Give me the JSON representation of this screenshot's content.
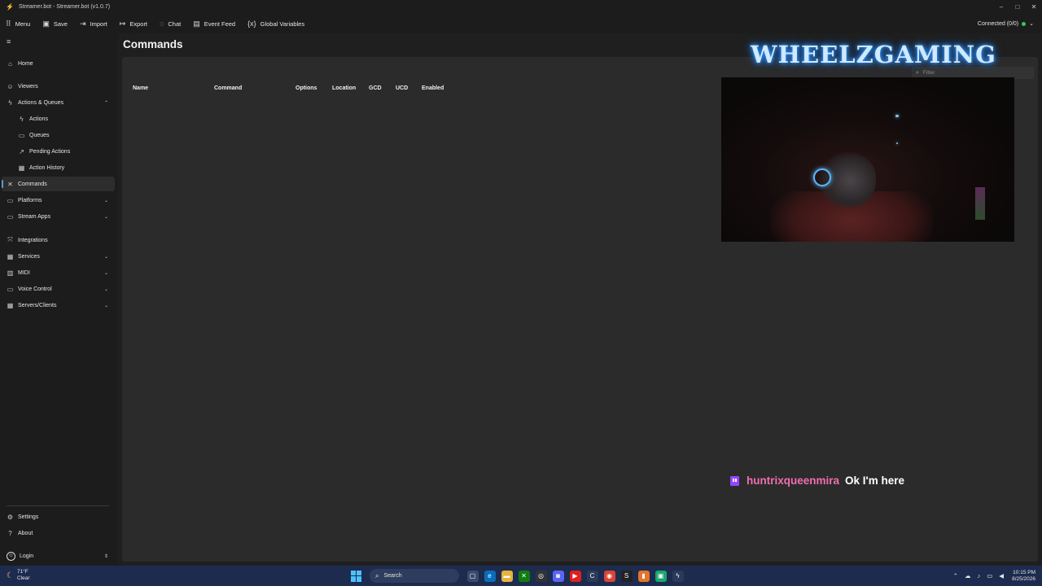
{
  "window": {
    "title": "Streamer.bot - Streamer.bot (v1.0.7)",
    "controls": [
      "–",
      "□",
      "✕"
    ]
  },
  "toolbar": {
    "items": [
      {
        "label": "Menu",
        "icon": "grid-icon"
      },
      {
        "label": "Save",
        "icon": "save-icon"
      },
      {
        "label": "Import",
        "icon": "import-icon"
      },
      {
        "label": "Export",
        "icon": "export-icon"
      },
      {
        "label": "Chat",
        "icon": "chat-icon"
      },
      {
        "label": "Event Feed",
        "icon": "feed-icon"
      },
      {
        "label": "Global Variables",
        "icon": "variables-icon"
      }
    ],
    "connection": "Connected (0/0)",
    "connection_color": "#35c759"
  },
  "sidebar": {
    "items": [
      {
        "label": "Home",
        "icon": "home-icon"
      },
      {
        "label": "Viewers",
        "icon": "viewers-icon"
      },
      {
        "label": "Actions & Queues",
        "icon": "actions-icon",
        "expanded": true
      },
      {
        "label": "Actions",
        "icon": "bolt-icon"
      },
      {
        "label": "Queues",
        "icon": "queue-icon"
      },
      {
        "label": "Pending Actions",
        "icon": "pending-icon"
      },
      {
        "label": "Action History",
        "icon": "history-icon"
      },
      {
        "label": "Commands",
        "icon": "commands-icon",
        "active": true
      },
      {
        "label": "Platforms",
        "icon": "platforms-icon"
      },
      {
        "label": "Stream Apps",
        "icon": "stream-apps-icon"
      },
      {
        "label": "Integrations",
        "icon": "integrations-icon"
      },
      {
        "label": "Services",
        "icon": "services-icon"
      },
      {
        "label": "MIDI",
        "icon": "midi-icon"
      },
      {
        "label": "Voice Control",
        "icon": "voice-icon"
      },
      {
        "label": "Servers/Clients",
        "icon": "servers-icon"
      }
    ],
    "bottom": [
      {
        "label": "Settings",
        "icon": "gear-icon"
      },
      {
        "label": "About",
        "icon": "help-icon"
      },
      {
        "label": "Login",
        "icon": "user-icon"
      }
    ]
  },
  "main": {
    "title": "Commands",
    "filter_placeholder": "Filter",
    "columns": [
      "Name",
      "Command",
      "Options",
      "Location",
      "GCD",
      "UCD",
      "Enabled"
    ]
  },
  "overlay": {
    "title": "WHEELZGAMING",
    "chat": {
      "platform": "twitch-icon",
      "user": "huntrixqueenmira",
      "message": "Ok I'm here",
      "user_color": "#f06fae"
    }
  },
  "taskbar": {
    "weather_temp": "71°F",
    "weather_desc": "Clear",
    "search": "Search",
    "time": "10:15 PM",
    "date": "8/25/2026"
  }
}
